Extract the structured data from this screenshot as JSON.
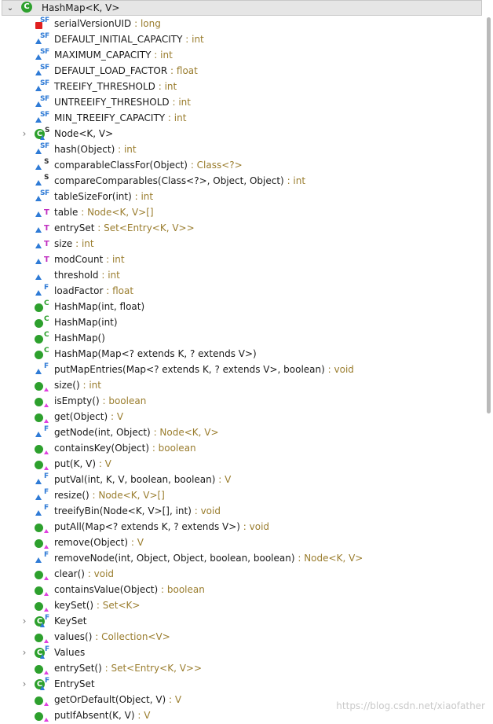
{
  "root": {
    "toggle": "⌄",
    "badge": "C",
    "label": "HashMap<K, V>"
  },
  "items": [
    {
      "icon": "sq-sf",
      "name": "serialVersionUID",
      "type": "long"
    },
    {
      "icon": "tri-sf",
      "name": "DEFAULT_INITIAL_CAPACITY",
      "type": "int"
    },
    {
      "icon": "tri-sf",
      "name": "MAXIMUM_CAPACITY",
      "type": "int"
    },
    {
      "icon": "tri-sf",
      "name": "DEFAULT_LOAD_FACTOR",
      "type": "float"
    },
    {
      "icon": "tri-sf",
      "name": "TREEIFY_THRESHOLD",
      "type": "int"
    },
    {
      "icon": "tri-sf",
      "name": "UNTREEIFY_THRESHOLD",
      "type": "int"
    },
    {
      "icon": "tri-sf",
      "name": "MIN_TREEIFY_CAPACITY",
      "type": "int"
    },
    {
      "icon": "class-s",
      "name": "Node<K, V>",
      "type": "",
      "expandable": true
    },
    {
      "icon": "tri-sf",
      "name": "hash(Object)",
      "type": "int"
    },
    {
      "icon": "tri-s",
      "name": "comparableClassFor(Object)",
      "type": "Class<?>"
    },
    {
      "icon": "tri-s",
      "name": "compareComparables(Class<?>, Object, Object)",
      "type": "int"
    },
    {
      "icon": "tri-sf",
      "name": "tableSizeFor(int)",
      "type": "int"
    },
    {
      "icon": "tri-t",
      "name": "table",
      "type": "Node<K, V>[]"
    },
    {
      "icon": "tri-t",
      "name": "entrySet",
      "type": "Set<Entry<K, V>>"
    },
    {
      "icon": "tri-t",
      "name": "size",
      "type": "int"
    },
    {
      "icon": "tri-t",
      "name": "modCount",
      "type": "int"
    },
    {
      "icon": "tri",
      "name": "threshold",
      "type": "int"
    },
    {
      "icon": "tri-f",
      "name": "loadFactor",
      "type": "float"
    },
    {
      "icon": "dot-c",
      "name": "HashMap(int, float)",
      "type": ""
    },
    {
      "icon": "dot-c",
      "name": "HashMap(int)",
      "type": ""
    },
    {
      "icon": "dot-c",
      "name": "HashMap()",
      "type": ""
    },
    {
      "icon": "dot-c",
      "name": "HashMap(Map<? extends K, ? extends V>)",
      "type": ""
    },
    {
      "icon": "tri-f",
      "name": "putMapEntries(Map<? extends K, ? extends V>, boolean)",
      "type": "void"
    },
    {
      "icon": "dot-o",
      "name": "size()",
      "type": "int"
    },
    {
      "icon": "dot-o",
      "name": "isEmpty()",
      "type": "boolean"
    },
    {
      "icon": "dot-o",
      "name": "get(Object)",
      "type": "V"
    },
    {
      "icon": "tri-f",
      "name": "getNode(int, Object)",
      "type": "Node<K, V>"
    },
    {
      "icon": "dot-o",
      "name": "containsKey(Object)",
      "type": "boolean"
    },
    {
      "icon": "dot-o",
      "name": "put(K, V)",
      "type": "V"
    },
    {
      "icon": "tri-f",
      "name": "putVal(int, K, V, boolean, boolean)",
      "type": "V"
    },
    {
      "icon": "tri-f",
      "name": "resize()",
      "type": "Node<K, V>[]"
    },
    {
      "icon": "tri-f",
      "name": "treeifyBin(Node<K, V>[], int)",
      "type": "void"
    },
    {
      "icon": "dot-o",
      "name": "putAll(Map<? extends K, ? extends V>)",
      "type": "void"
    },
    {
      "icon": "dot-o",
      "name": "remove(Object)",
      "type": "V"
    },
    {
      "icon": "tri-f",
      "name": "removeNode(int, Object, Object, boolean, boolean)",
      "type": "Node<K, V>"
    },
    {
      "icon": "dot-o",
      "name": "clear()",
      "type": "void"
    },
    {
      "icon": "dot-o",
      "name": "containsValue(Object)",
      "type": "boolean"
    },
    {
      "icon": "dot-o",
      "name": "keySet()",
      "type": "Set<K>"
    },
    {
      "icon": "class-f",
      "name": "KeySet",
      "type": "",
      "expandable": true
    },
    {
      "icon": "dot-o",
      "name": "values()",
      "type": "Collection<V>"
    },
    {
      "icon": "class-f",
      "name": "Values",
      "type": "",
      "expandable": true
    },
    {
      "icon": "dot-o",
      "name": "entrySet()",
      "type": "Set<Entry<K, V>>"
    },
    {
      "icon": "class-f",
      "name": "EntrySet",
      "type": "",
      "expandable": true
    },
    {
      "icon": "dot-o",
      "name": "getOrDefault(Object, V)",
      "type": "V"
    },
    {
      "icon": "dot-o",
      "name": "putIfAbsent(K, V)",
      "type": "V"
    }
  ],
  "watermark": "https://blog.csdn.net/xiaofather"
}
